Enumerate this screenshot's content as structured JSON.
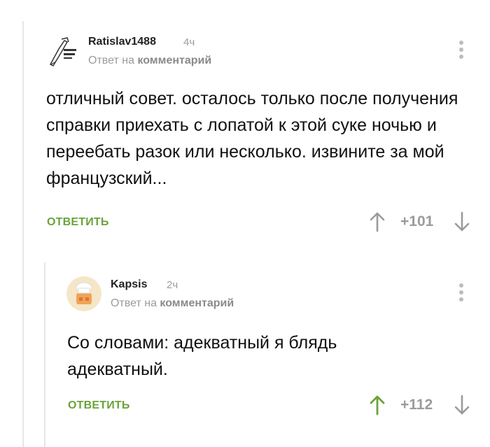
{
  "comments": [
    {
      "author": "Ratislav1488",
      "time": "4ч",
      "reply_prefix": "Ответ на",
      "reply_target": "комментарий",
      "text": "отличный совет. осталось только после получения справки приехать с лопатой к этой суке ночью и переебать разок или несколько. извините за мой французский...",
      "reply_label": "ОТВЕТИТЬ",
      "rating": "+101",
      "avatar_icon": "sketch-avatar-icon"
    },
    {
      "author": "Kapsis",
      "time": "2ч",
      "reply_prefix": "Ответ на",
      "reply_target": "комментарий",
      "text": "Со словами: адекватный я блядь адекватный.",
      "reply_label": "ОТВЕТИТЬ",
      "rating": "+112",
      "avatar_icon": "chef-avatar-icon"
    }
  ],
  "colors": {
    "accent_green": "#6aa33b",
    "muted_gray": "#9b9b9b",
    "thread_line": "#e6e6e6"
  }
}
